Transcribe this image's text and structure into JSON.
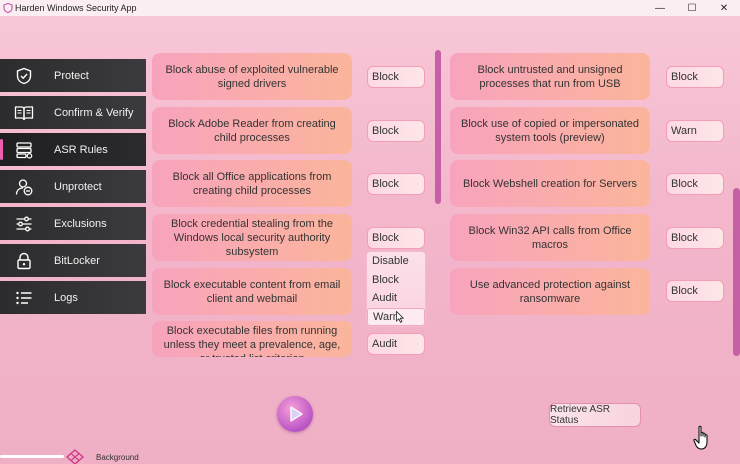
{
  "window": {
    "title": "Harden Windows Security App",
    "controls": {
      "minimize": "—",
      "maximize": "☐",
      "close": "✕"
    }
  },
  "nav": {
    "items": [
      {
        "label": "Protect",
        "icon": "shield-icon"
      },
      {
        "label": "Confirm & Verify",
        "icon": "book-icon"
      },
      {
        "label": "ASR Rules",
        "icon": "server-list-icon",
        "active": true
      },
      {
        "label": "Unprotect",
        "icon": "user-remove-icon"
      },
      {
        "label": "Exclusions",
        "icon": "sliders-icon"
      },
      {
        "label": "BitLocker",
        "icon": "lock-icon"
      },
      {
        "label": "Logs",
        "icon": "list-icon"
      }
    ]
  },
  "rules_left": [
    {
      "label": "Block abuse of exploited vulnerable signed drivers",
      "value": "Block"
    },
    {
      "label": "Block Adobe Reader from creating child processes",
      "value": "Block"
    },
    {
      "label": "Block all Office applications from creating child processes",
      "value": "Block"
    },
    {
      "label": "Block credential stealing from the Windows local security authority subsystem",
      "value": "Block"
    },
    {
      "label": "Block executable content from email client and webmail",
      "value": ""
    },
    {
      "label": "Block executable files from running unless they meet a prevalence, age, or trusted list criterion",
      "value": "Audit"
    }
  ],
  "rules_right": [
    {
      "label": "Block untrusted and unsigned processes that run from USB",
      "value": "Block"
    },
    {
      "label": "Block use of copied or impersonated system tools (preview)",
      "value": "Warn"
    },
    {
      "label": "Block Webshell creation for Servers",
      "value": "Block"
    },
    {
      "label": "Block Win32 API calls from Office macros",
      "value": "Block"
    },
    {
      "label": "Use advanced protection against ransomware",
      "value": "Block"
    }
  ],
  "dropdown": {
    "options": [
      "Disable",
      "Block",
      "Audit",
      "Warn"
    ],
    "hovered": "Warn"
  },
  "actions": {
    "run_icon": "play-icon",
    "retrieve_label": "Retrieve ASR Status"
  },
  "footer": {
    "background_label": "Background"
  },
  "colors": {
    "accent": "#c65fa6",
    "nav_bg": "#2c2c2e",
    "nav_active_bar": "#ee5fb0"
  }
}
